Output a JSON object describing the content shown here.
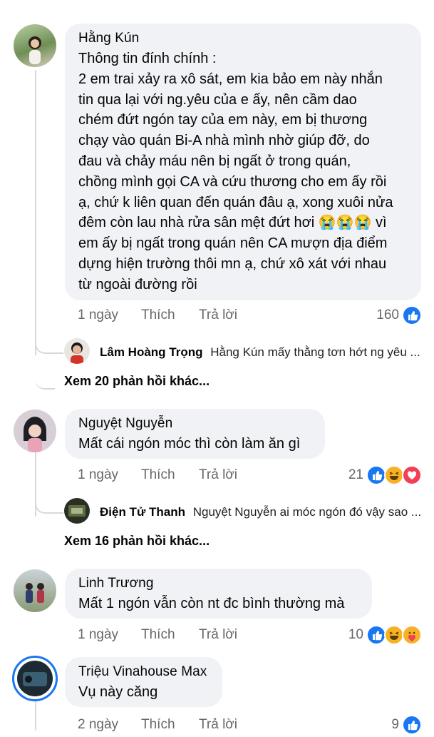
{
  "comments": [
    {
      "name": "Hằng Kún",
      "text": "Thông tin đính chính :\n2 em trai xảy ra xô sát, em kia bảo em này nhắn\ntin qua lại với ng.yêu của e ấy, nên cầm dao\nchém đứt ngón tay của em này, em bị thương\nchạy vào quán Bi-A nhà mình nhờ giúp đỡ, do\nđau và chảy máu nên bị ngất ở trong quán,\nchồng mình gọi CA và cứu thương cho em ấy rồi\nạ, chứ k liên quan đến quán đâu ạ, xong xuôi nửa\nđêm còn lau nhà rửa sân mệt đứt hơi 😭😭😭 vì\nem ấy bị ngất trong quán nên CA mượn địa điểm\ndựng hiện trường thôi mn ạ, chứ xô xát với nhau\ntừ ngoài đường rồi",
      "time": "1 ngày",
      "like": "Thích",
      "reply": "Trả lời",
      "count": "160",
      "reactions": [
        "like"
      ],
      "preview_reply": {
        "name": "Lâm Hoàng Trọng",
        "text": "Hằng Kún mấy thằng tơn hớt ng yêu ..."
      },
      "more": "Xem 20 phản hồi khác..."
    },
    {
      "name": "Nguyệt Nguyễn",
      "text": "Mất cái ngón móc thì còn làm ăn gì",
      "time": "1 ngày",
      "like": "Thích",
      "reply": "Trả lời",
      "count": "21",
      "reactions": [
        "like",
        "haha",
        "love"
      ],
      "preview_reply": {
        "name": "Điện Tử Thanh",
        "text": "Nguyệt Nguyễn ai móc ngón đó vậy sao ..."
      },
      "more": "Xem 16 phản hồi khác..."
    },
    {
      "name": "Linh Trương",
      "text": "Mất 1 ngón vẫn còn nt đc bình thường mà",
      "time": "1 ngày",
      "like": "Thích",
      "reply": "Trả lời",
      "count": "10",
      "reactions": [
        "like",
        "haha",
        "care"
      ]
    },
    {
      "name": "Triệu Vinahouse Max",
      "text": "Vụ này căng",
      "time": "2 ngày",
      "like": "Thích",
      "reply": "Trả lời",
      "count": "9",
      "reactions": [
        "like"
      ]
    }
  ],
  "colors": {
    "bubble": "#f0f2f5",
    "like_blue": "#1877f2",
    "love_red": "#f33e58",
    "haha_yellow": "#f7b125",
    "meta_gray": "#65676b"
  }
}
